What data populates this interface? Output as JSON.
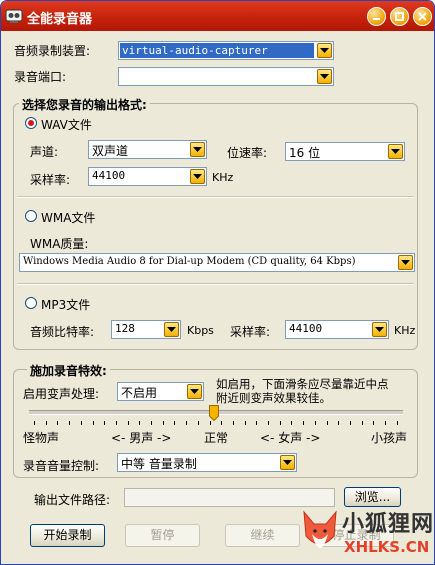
{
  "window": {
    "title": "全能录音器"
  },
  "device": {
    "label": "音频录制装置:",
    "value": "virtual-audio-capturer"
  },
  "port": {
    "label": "录音端口:",
    "value": ""
  },
  "format_group": {
    "title": "选择您录音的输出格式:",
    "wav": {
      "label": "WAV文件",
      "channel_label": "声道:",
      "channel_value": "双声道",
      "bitrate_label": "位速率:",
      "bitrate_value": "16 位",
      "samplerate_label": "采样率:",
      "samplerate_value": "44100",
      "samplerate_unit": "KHz"
    },
    "wma": {
      "label": "WMA文件",
      "quality_label": "WMA质量:",
      "quality_value": "Windows Media Audio 8 for Dial-up Modem (CD quality, 64 Kbps)"
    },
    "mp3": {
      "label": "MP3文件",
      "bitrate_label": "音频比特率:",
      "bitrate_value": "128",
      "bitrate_unit": "Kbps",
      "samplerate_label": "采样率:",
      "samplerate_value": "44100",
      "samplerate_unit": "KHz"
    }
  },
  "effects_group": {
    "title": "施加录音特效:",
    "voice_label": "启用变声处理:",
    "voice_value": "不启用",
    "hint": "如启用，下面滑条应尽量靠近中点附近则变声效果较佳。",
    "scale": [
      "怪物声",
      "<- 男声 ->",
      "正常",
      "<- 女声 ->",
      "小孩声"
    ],
    "volume_label": "录音音量控制:",
    "volume_value": "中等 音量录制"
  },
  "output": {
    "label": "输出文件路径:",
    "browse": "浏览..."
  },
  "buttons": {
    "start": "开始录制",
    "pause": "暂停",
    "resume": "继续",
    "stop": "停止录制"
  },
  "watermark": {
    "title": "小狐狸网",
    "url": "XHLKS.CN"
  }
}
